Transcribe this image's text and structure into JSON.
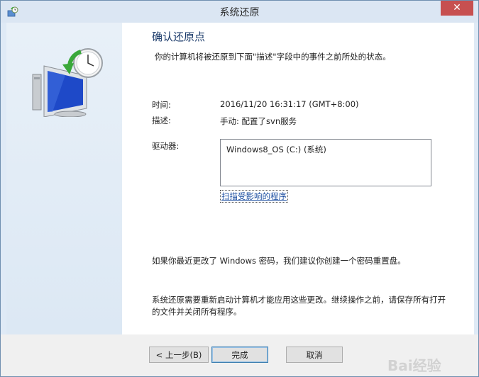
{
  "window": {
    "title": "系统还原",
    "close_glyph": "✕"
  },
  "main": {
    "heading": "确认还原点",
    "intro": "你的计算机将被还原到下面\"描述\"字段中的事件之前所处的状态。",
    "time_label": "时间:",
    "time_value": "2016/11/20 16:31:17 (GMT+8:00)",
    "desc_label": "描述:",
    "desc_value": "手动: 配置了svn服务",
    "drives_label": "驱动器:",
    "drives": [
      "Windows8_OS (C:) (系统)"
    ],
    "scan_link": "扫描受影响的程序",
    "note_password": "如果你最近更改了 Windows 密码，我们建议你创建一个密码重置盘。",
    "note_restart": "系统还原需要重新启动计算机才能应用这些更改。继续操作之前，请保存所有打开的文件并关闭所有程序。"
  },
  "footer": {
    "back_label": "< 上一步(B)",
    "finish_label": "完成",
    "cancel_label": "取消"
  },
  "watermark": {
    "text": "Bai经验"
  },
  "icons": {
    "app": "system-restore-icon",
    "illustration": "computer-clock-restore-icon"
  }
}
